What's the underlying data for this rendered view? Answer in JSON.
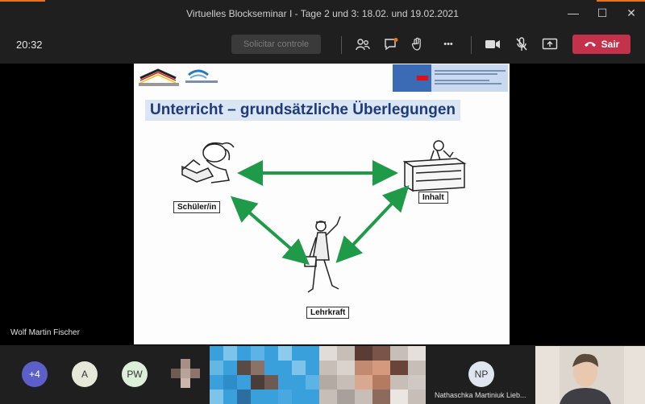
{
  "window": {
    "title": "Virtuelles Blockseminar I - Tage 2 und 3: 18.02. und 19.02.2021",
    "minimize": "—",
    "maximize": "☐",
    "close": "✕"
  },
  "toolbar": {
    "time": "20:32",
    "request_control": "Solicitar controle",
    "leave_label": "Sair",
    "more": "•••"
  },
  "slide": {
    "heading": "Unterricht – grundsätzliche Überlegungen",
    "labels": {
      "student": "Schüler/in",
      "content": "Inhalt",
      "teacher": "Lehrkraft"
    }
  },
  "presenter_name": "Wolf Martin Fischer",
  "participants": {
    "overflow": "+4",
    "a": "A",
    "pw": "PW",
    "np": "NP",
    "np_name": "Nathaschka Martiniuk Lieb..."
  },
  "colors": {
    "leave": "#c4314b",
    "arrow": "#1f9a48",
    "heading_bg": "#dbe6f5"
  }
}
